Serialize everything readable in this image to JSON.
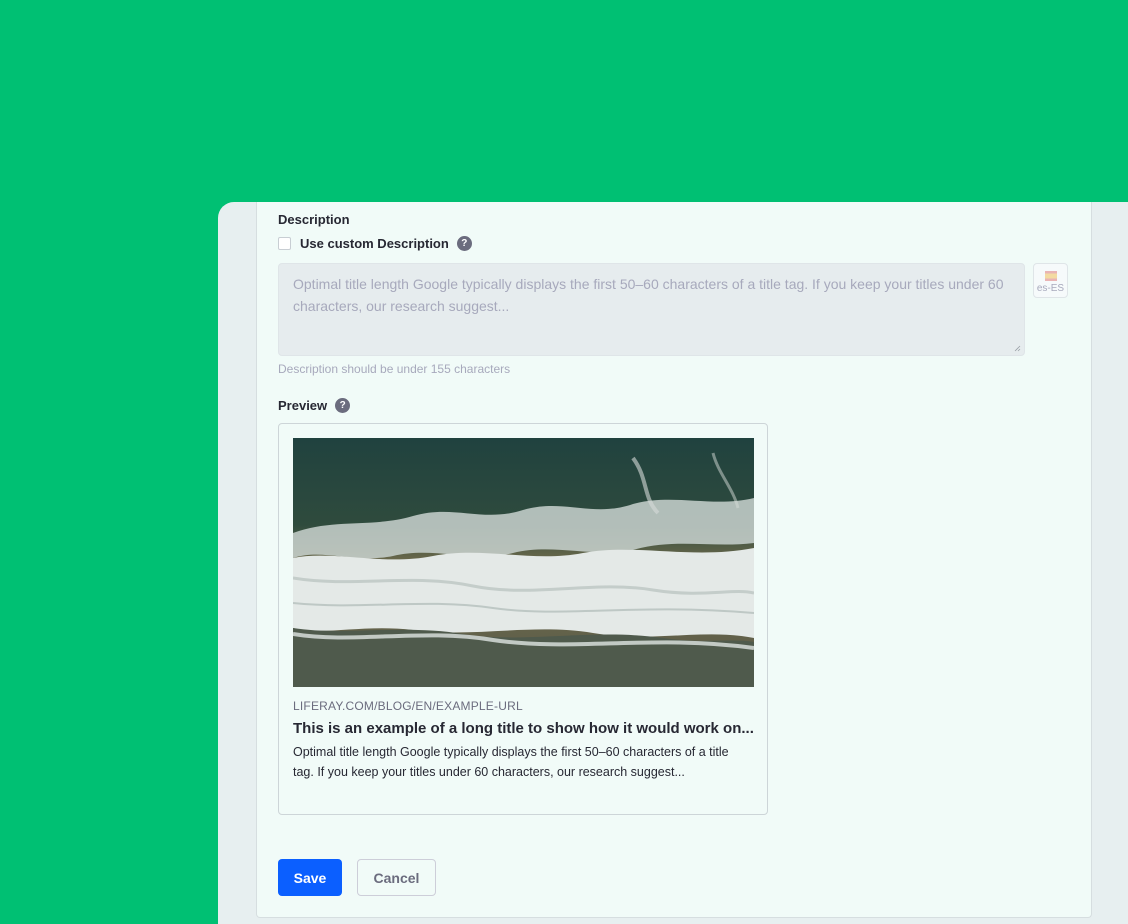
{
  "description_section": {
    "label": "Description",
    "use_custom_label": "Use custom Description",
    "use_custom_checked": false,
    "textarea_text": "Optimal title length Google typically displays the first 50–60 characters of a title tag. If you keep your titles under 60 characters, our research suggest...",
    "locale": "es-ES",
    "help_text": "Description should be under 155 characters"
  },
  "preview_section": {
    "label": "Preview",
    "url": "LIFERAY.COM/BLOG/EN/EXAMPLE-URL",
    "title": "This is an example of a long title to show how it would work on...",
    "description": "Optimal title length Google typically displays the first 50–60 characters of a title tag. If you keep your titles under 60 characters, our research suggest..."
  },
  "actions": {
    "save_label": "Save",
    "cancel_label": "Cancel"
  },
  "icons": {
    "help": "question-circle-icon",
    "locale_flag": "spain-flag-icon"
  },
  "colors": {
    "background": "#00c073",
    "primary_button": "#0b5fff",
    "card_background": "#f1fbf8",
    "help_icon": "#6b6c7e"
  }
}
